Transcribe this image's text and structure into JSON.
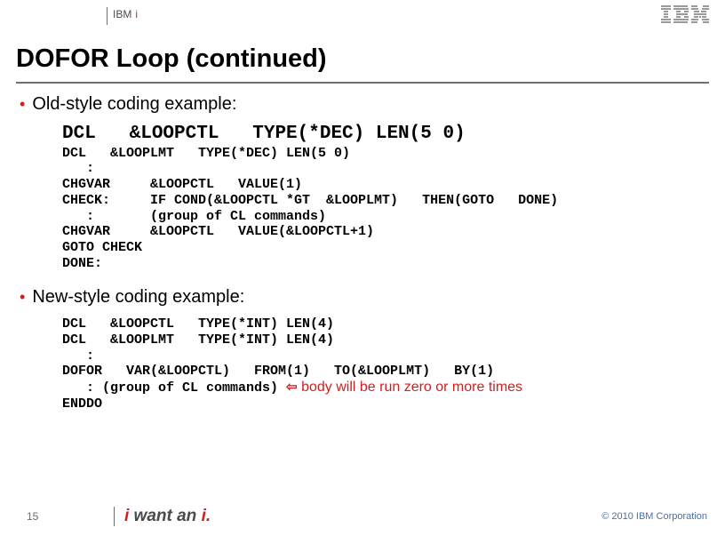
{
  "header": {
    "brand_prefix": "IBM",
    "brand_suffix": "i"
  },
  "title": "DOFOR Loop   (continued)",
  "bullet1": "Old-style coding example:",
  "code_old_lg": "DCL   &LOOPCTL   TYPE(*DEC) LEN(5 0)",
  "code_old_sm": "DCL   &LOOPLMT   TYPE(*DEC) LEN(5 0)\n   :\nCHGVAR     &LOOPCTL   VALUE(1)\nCHECK:     IF COND(&LOOPCTL *GT  &LOOPLMT)   THEN(GOTO   DONE)\n   :       (group of CL commands)\nCHGVAR     &LOOPCTL   VALUE(&LOOPCTL+1)\nGOTO CHECK\nDONE:",
  "bullet2": "New-style coding example:",
  "code_new_pre": "DCL   &LOOPCTL   TYPE(*INT) LEN(4)\nDCL   &LOOPLMT   TYPE(*INT) LEN(4)\n   :\nDOFOR   VAR(&LOOPCTL)   FROM(1)   TO(&LOOPLMT)   BY(1)",
  "code_new_body_line_prefix": "   : (group of CL commands) ",
  "code_new_note": " body will be run zero or more times",
  "code_new_post": "ENDDO",
  "footer": {
    "page": "15",
    "tagline_prefix": "i",
    "tagline_mid": " want an ",
    "tagline_suffix": "i.",
    "copyright": "© 2010 IBM Corporation"
  }
}
